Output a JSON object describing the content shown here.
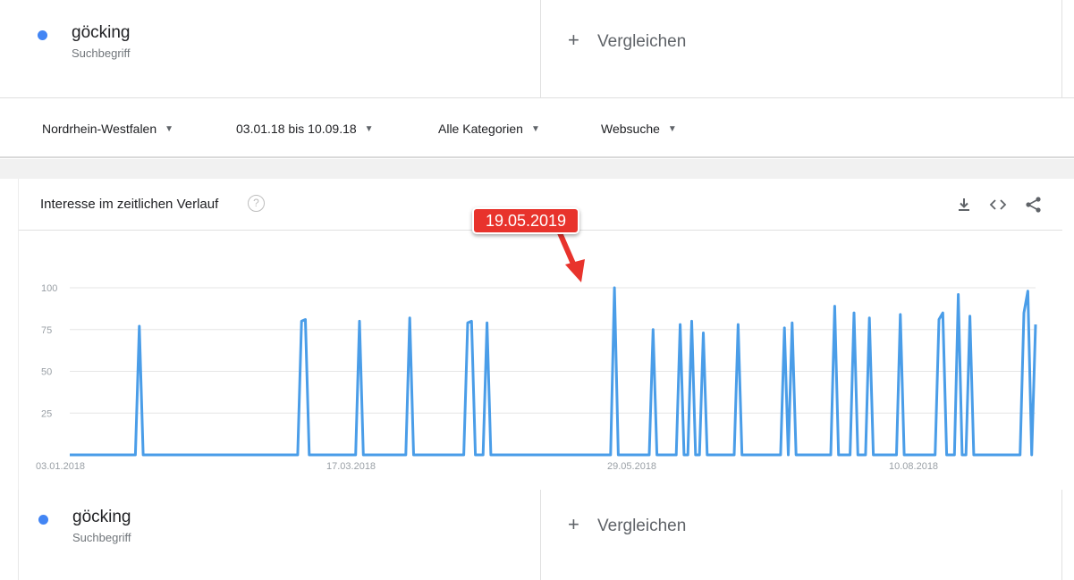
{
  "term": {
    "name": "göcking",
    "subtitle": "Suchbegriff"
  },
  "compare": {
    "plus": "+",
    "label": "Vergleichen"
  },
  "filters": [
    {
      "label": "Nordrhein-Westfalen"
    },
    {
      "label": "03.01.18 bis 10.09.18"
    },
    {
      "label": "Alle Kategorien"
    },
    {
      "label": "Websuche"
    }
  ],
  "card": {
    "title": "Interesse im zeitlichen Verlauf",
    "help": "?"
  },
  "callout": {
    "text": "19.05.2019"
  },
  "icons": {
    "download": "download-icon",
    "embed": "embed-icon",
    "share": "share-icon",
    "help": "help-icon",
    "dropdown": "caret-down-icon"
  },
  "colors": {
    "series": "#4a9de8",
    "term_dot": "#4285f4",
    "callout": "#e8332c",
    "grid": "#e6e6e6"
  },
  "chart_data": {
    "type": "line",
    "xlabel": "",
    "ylabel": "",
    "ylim": [
      0,
      100
    ],
    "yticks": [
      25,
      50,
      75,
      100
    ],
    "xtick_labels": [
      "03.01.2018",
      "17.03.2018",
      "29.05.2018",
      "10.08.2018"
    ],
    "xrange": [
      "2018-01-03",
      "2018-09-10"
    ],
    "series": [
      {
        "points": [
          [
            "2018-01-03",
            0
          ],
          [
            "2018-01-20",
            0
          ],
          [
            "2018-01-21",
            77
          ],
          [
            "2018-01-22",
            0
          ],
          [
            "2018-03-03",
            0
          ],
          [
            "2018-03-04",
            80
          ],
          [
            "2018-03-05",
            81
          ],
          [
            "2018-03-06",
            0
          ],
          [
            "2018-03-18",
            0
          ],
          [
            "2018-03-19",
            80
          ],
          [
            "2018-03-20",
            0
          ],
          [
            "2018-03-31",
            0
          ],
          [
            "2018-04-01",
            82
          ],
          [
            "2018-04-02",
            0
          ],
          [
            "2018-04-15",
            0
          ],
          [
            "2018-04-16",
            79
          ],
          [
            "2018-04-17",
            80
          ],
          [
            "2018-04-18",
            0
          ],
          [
            "2018-04-20",
            0
          ],
          [
            "2018-04-21",
            79
          ],
          [
            "2018-04-22",
            0
          ],
          [
            "2018-05-23",
            0
          ],
          [
            "2018-05-24",
            100
          ],
          [
            "2018-05-25",
            0
          ],
          [
            "2018-06-02",
            0
          ],
          [
            "2018-06-03",
            75
          ],
          [
            "2018-06-04",
            0
          ],
          [
            "2018-06-09",
            0
          ],
          [
            "2018-06-10",
            78
          ],
          [
            "2018-06-11",
            0
          ],
          [
            "2018-06-12",
            0
          ],
          [
            "2018-06-13",
            80
          ],
          [
            "2018-06-14",
            0
          ],
          [
            "2018-06-15",
            0
          ],
          [
            "2018-06-16",
            73
          ],
          [
            "2018-06-17",
            0
          ],
          [
            "2018-06-24",
            0
          ],
          [
            "2018-06-25",
            78
          ],
          [
            "2018-06-26",
            0
          ],
          [
            "2018-07-06",
            0
          ],
          [
            "2018-07-07",
            76
          ],
          [
            "2018-07-08",
            0
          ],
          [
            "2018-07-09",
            79
          ],
          [
            "2018-07-10",
            0
          ],
          [
            "2018-07-19",
            0
          ],
          [
            "2018-07-20",
            89
          ],
          [
            "2018-07-21",
            0
          ],
          [
            "2018-07-24",
            0
          ],
          [
            "2018-07-25",
            85
          ],
          [
            "2018-07-26",
            0
          ],
          [
            "2018-07-28",
            0
          ],
          [
            "2018-07-29",
            82
          ],
          [
            "2018-07-30",
            0
          ],
          [
            "2018-08-05",
            0
          ],
          [
            "2018-08-06",
            84
          ],
          [
            "2018-08-07",
            0
          ],
          [
            "2018-08-15",
            0
          ],
          [
            "2018-08-16",
            81
          ],
          [
            "2018-08-17",
            85
          ],
          [
            "2018-08-18",
            0
          ],
          [
            "2018-08-20",
            0
          ],
          [
            "2018-08-21",
            96
          ],
          [
            "2018-08-22",
            0
          ],
          [
            "2018-08-23",
            0
          ],
          [
            "2018-08-24",
            83
          ],
          [
            "2018-08-25",
            0
          ],
          [
            "2018-09-06",
            0
          ],
          [
            "2018-09-07",
            85
          ],
          [
            "2018-09-08",
            98
          ],
          [
            "2018-09-09",
            0
          ],
          [
            "2018-09-10",
            78
          ]
        ]
      }
    ]
  }
}
